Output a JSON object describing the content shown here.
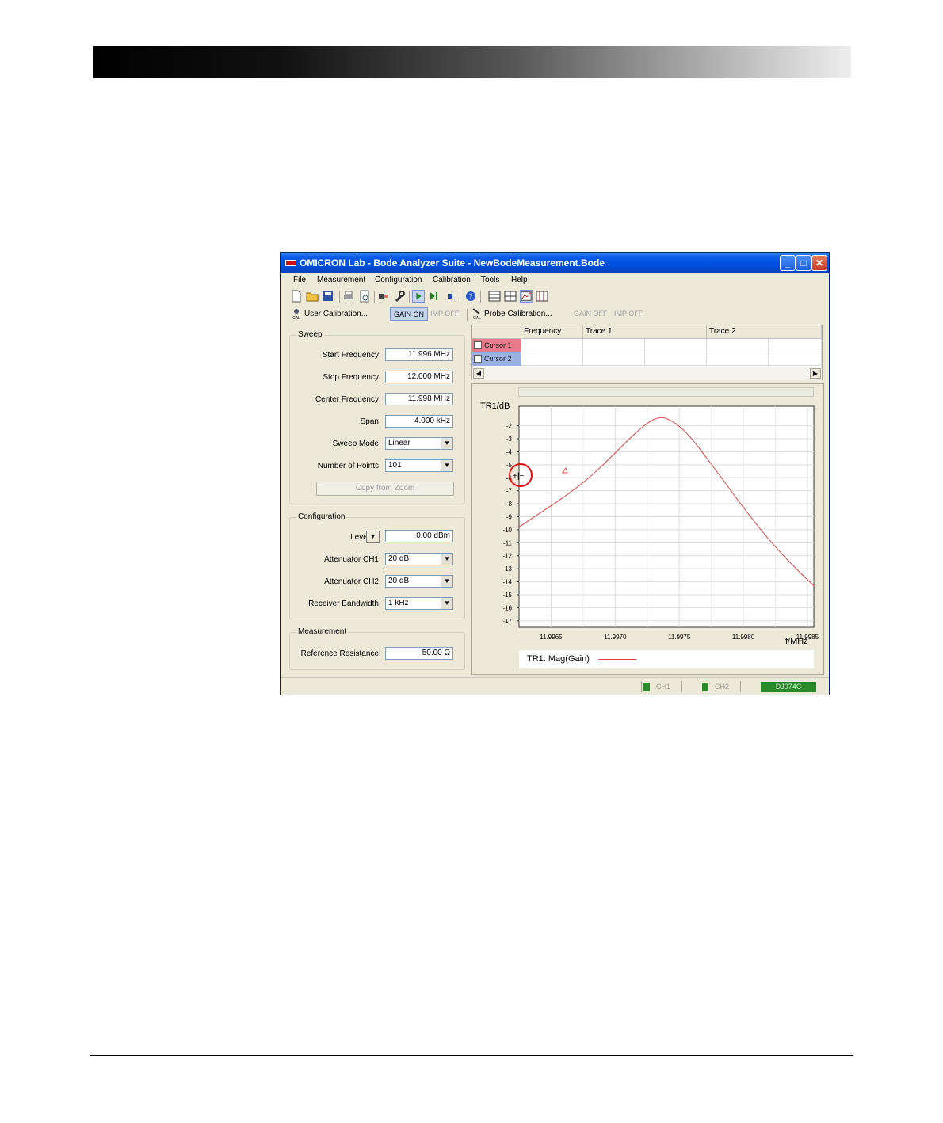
{
  "window": {
    "title": "OMICRON Lab - Bode Analyzer Suite - NewBodeMeasurement.Bode",
    "minimize": "_",
    "maximize": "□",
    "close": "✕"
  },
  "menu": [
    "File",
    "Measurement",
    "Configuration",
    "Calibration",
    "Tools",
    "Help"
  ],
  "calbar": {
    "user_calibration": "User Calibration...",
    "gain_on": "GAIN ON",
    "imp_off": "IMP OFF",
    "probe_calibration": "Probe Calibration...",
    "probe_gain_off": "GAIN OFF",
    "probe_imp_off": "IMP OFF"
  },
  "sweep": {
    "title": "Sweep",
    "start_frequency_label": "Start Frequency",
    "start_frequency": "11.996 MHz",
    "stop_frequency_label": "Stop Frequency",
    "stop_frequency": "12.000 MHz",
    "center_frequency_label": "Center Frequency",
    "center_frequency": "11.998 MHz",
    "span_label": "Span",
    "span": "4.000 kHz",
    "sweep_mode_label": "Sweep Mode",
    "sweep_mode": "Linear",
    "points_label": "Number of Points",
    "points": "101",
    "copy_from_zoom": "Copy from Zoom"
  },
  "configuration": {
    "title": "Configuration",
    "level_label": "Level",
    "level": "0.00 dBm",
    "att_ch1_label": "Attenuator CH1",
    "att_ch1": "20 dB",
    "att_ch2_label": "Attenuator CH2",
    "att_ch2": "20 dB",
    "rbw_label": "Receiver Bandwidth",
    "rbw": "1 kHz"
  },
  "measurement": {
    "title": "Measurement",
    "ref_res_label": "Reference Resistance",
    "ref_res": "50.00 Ω"
  },
  "cursor_table": {
    "headers": [
      "Frequency",
      "Trace 1",
      "Trace 2"
    ],
    "cursor1": "Cursor 1",
    "cursor2": "Cursor 2",
    "cursor1_color": "#e87a8a",
    "cursor2_color": "#9ab0e0"
  },
  "status": {
    "ch1": "CH1",
    "ch2": "CH2",
    "device": "DJ074C"
  },
  "chart_data": {
    "type": "line",
    "ylabel": "TR1/dB",
    "xlabel": "f/MHz",
    "xlim": [
      11.99625,
      11.99855
    ],
    "ylim": [
      -17.5,
      -0.5
    ],
    "x_ticks": [
      11.9965,
      11.997,
      11.9975,
      11.998,
      11.9985
    ],
    "x_tick_labels": [
      "11.9965",
      "11.9970",
      "11.9975",
      "11.9980",
      "11.9985"
    ],
    "y_ticks": [
      -2,
      -3,
      -4,
      -5,
      -6,
      -7,
      -8,
      -9,
      -10,
      -11,
      -12,
      -13,
      -14,
      -15,
      -16,
      -17
    ],
    "y_tick_labels": [
      "-2",
      "-3",
      "-4",
      "-5",
      "-6",
      "-7",
      "-8",
      "-9",
      "-10",
      "-11",
      "-12",
      "-13",
      "-14",
      "-15",
      "-16",
      "-17"
    ],
    "grid": true,
    "series": [
      {
        "name": "TR1: Mag(Gain)",
        "color": "#e04040",
        "x": [
          11.99625,
          11.9964,
          11.9966,
          11.9968,
          11.997,
          11.9971,
          11.9972,
          11.99725,
          11.9973,
          11.99735,
          11.9974,
          11.9975,
          11.9976,
          11.9977,
          11.9978,
          11.998,
          11.9982,
          11.9984,
          11.99855
        ],
        "y": [
          -9.8,
          -8.8,
          -7.5,
          -6.0,
          -4.1,
          -3.1,
          -2.2,
          -1.8,
          -1.5,
          -1.35,
          -1.4,
          -2.0,
          -3.0,
          -4.3,
          -5.6,
          -8.3,
          -10.8,
          -12.9,
          -14.3
        ]
      }
    ]
  }
}
